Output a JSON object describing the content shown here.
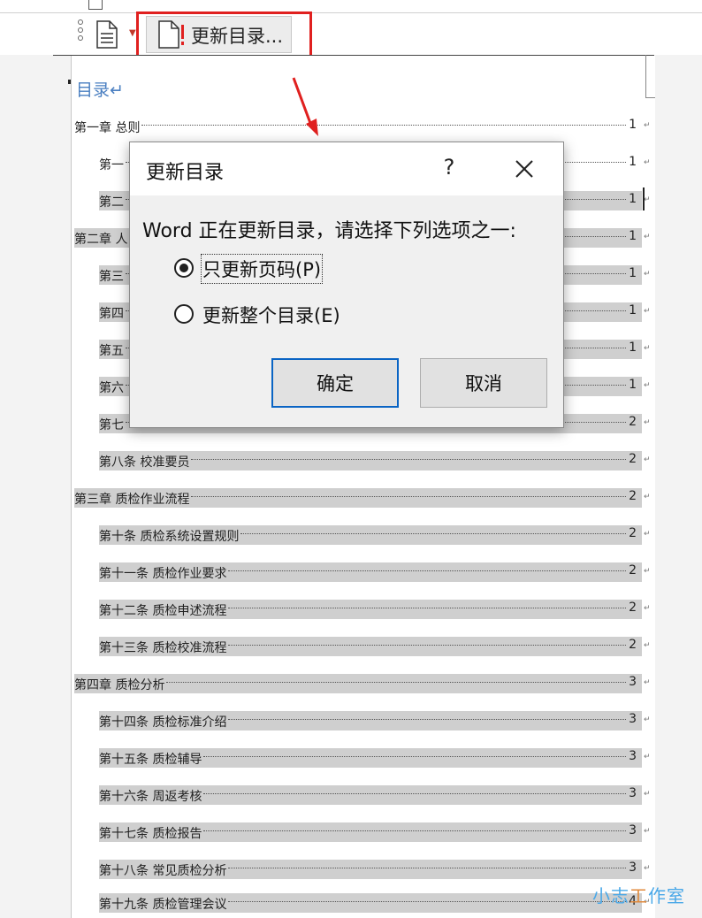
{
  "toolbar": {
    "update_button_label": "更新目录..."
  },
  "document": {
    "toc_heading": "目录↵",
    "entries": [
      {
        "text": "第一章 总则",
        "page": "1",
        "shaded": false
      },
      {
        "text": "第一",
        "page": "1",
        "shaded": false
      },
      {
        "text": "第二",
        "page": "1",
        "shaded": true
      },
      {
        "text": "第二章 人",
        "page": "1",
        "shaded": true
      },
      {
        "text": "第三",
        "page": "1",
        "shaded": true
      },
      {
        "text": "第四",
        "page": "1",
        "shaded": true
      },
      {
        "text": "第五",
        "page": "1",
        "shaded": true
      },
      {
        "text": "第六",
        "page": "1",
        "shaded": true
      },
      {
        "text": "第七",
        "page": "2",
        "shaded": true
      },
      {
        "text": "第八条 校准要员",
        "page": "2",
        "shaded": true
      },
      {
        "text": "第三章 质检作业流程",
        "page": "2",
        "shaded": true
      },
      {
        "text": "第十条 质检系统设置规则",
        "page": "2",
        "shaded": true
      },
      {
        "text": "第十一条 质检作业要求",
        "page": "2",
        "shaded": true
      },
      {
        "text": "第十二条 质检申述流程",
        "page": "2",
        "shaded": true
      },
      {
        "text": "第十三条 质检校准流程",
        "page": "2",
        "shaded": true
      },
      {
        "text": "第四章 质检分析",
        "page": "3",
        "shaded": true
      },
      {
        "text": "第十四条 质检标准介绍",
        "page": "3",
        "shaded": true
      },
      {
        "text": "第十五条 质检辅导",
        "page": "3",
        "shaded": true
      },
      {
        "text": "第十六条 周返考核",
        "page": "3",
        "shaded": true
      },
      {
        "text": "第十七条 质检报告",
        "page": "3",
        "shaded": true
      },
      {
        "text": "第十八条 常见质检分析",
        "page": "3",
        "shaded": true
      },
      {
        "text": "第十九条 质检管理会议",
        "page": "4",
        "shaded": true
      }
    ]
  },
  "dialog": {
    "title": "更新目录",
    "help": "?",
    "message": "Word 正在更新目录，请选择下列选项之一:",
    "options": [
      {
        "label": "只更新页码(P)",
        "checked": true
      },
      {
        "label": "更新整个目录(E)",
        "checked": false
      }
    ],
    "ok_label": "确定",
    "cancel_label": "取消"
  },
  "watermark": {
    "part1": "小志",
    "part2": "工",
    "part3": "作室"
  },
  "colors": {
    "highlight": "#e0201f",
    "heading_blue": "#4a7fc1",
    "default_button_border": "#0a64c4"
  }
}
